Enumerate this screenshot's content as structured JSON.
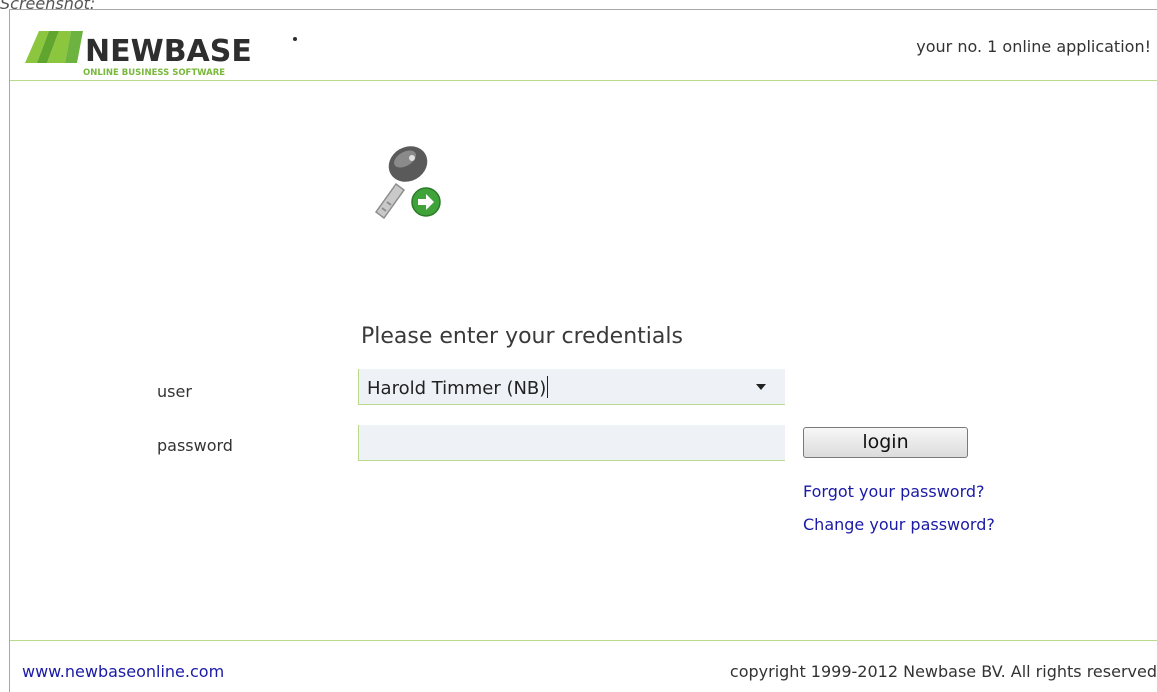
{
  "caption": "Screenshot:",
  "header": {
    "logo_text": "NEWBASE",
    "logo_subtext": "ONLINE BUSINESS SOFTWARE",
    "tagline": "your no. 1 online application!"
  },
  "icons": {
    "key": "key-login-icon",
    "arrow": "arrow-right-icon",
    "dropdown": "chevron-down-icon"
  },
  "form": {
    "title": "Please enter your credentials",
    "user_label": "user",
    "user_value": "Harold Timmer (NB)",
    "password_label": "password",
    "password_value": "",
    "login_label": "login",
    "forgot_link": "Forgot your password?",
    "change_link": "Change your password?"
  },
  "footer": {
    "website": "www.newbaseonline.com",
    "copyright": "copyright 1999-2012 Newbase BV. All rights reserved"
  },
  "colors": {
    "brand_green": "#78b83c",
    "brand_dark": "#2e2e2e",
    "divider": "#b9d98c",
    "link": "#1a1aa6",
    "input_bg": "#eef2f6"
  }
}
